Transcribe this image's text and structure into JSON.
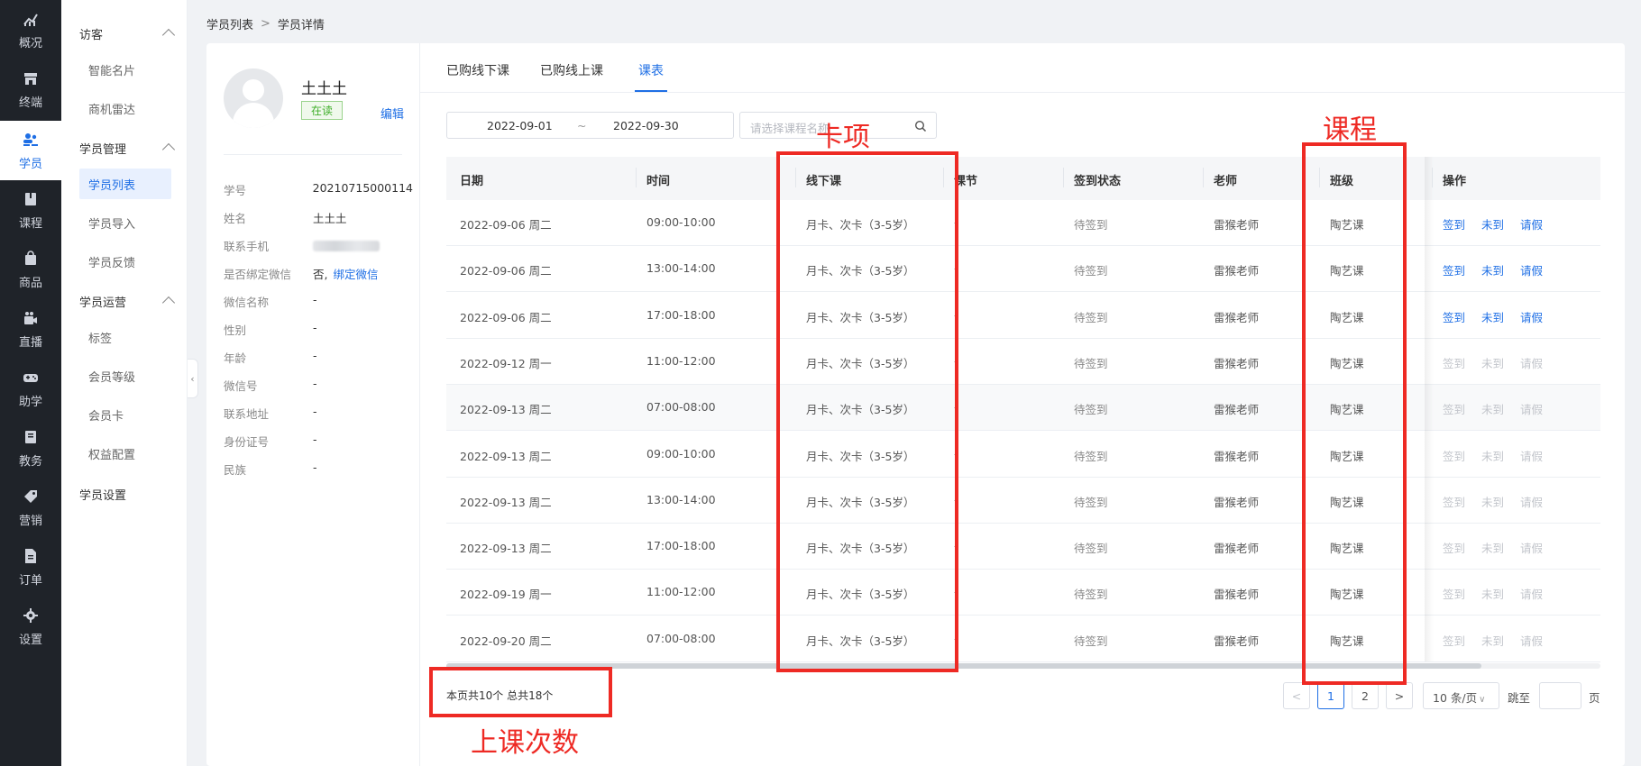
{
  "rail": {
    "items": [
      {
        "label": "概况",
        "icon": "chart-trend-icon"
      },
      {
        "label": "终端",
        "icon": "store-icon"
      },
      {
        "label": "学员",
        "icon": "users-icon",
        "active": true
      },
      {
        "label": "课程",
        "icon": "book-icon"
      },
      {
        "label": "商品",
        "icon": "bag-icon"
      },
      {
        "label": "直播",
        "icon": "video-camera-icon"
      },
      {
        "label": "助学",
        "icon": "gamepad-icon"
      },
      {
        "label": "教务",
        "icon": "notebook-icon"
      },
      {
        "label": "营销",
        "icon": "tag-icon"
      },
      {
        "label": "订单",
        "icon": "document-icon"
      },
      {
        "label": "设置",
        "icon": "gear-icon"
      }
    ]
  },
  "subnav": {
    "groups": [
      {
        "label": "访客",
        "items": [
          "智能名片",
          "商机雷达"
        ]
      },
      {
        "label": "学员管理",
        "items": [
          "学员列表",
          "学员导入",
          "学员反馈"
        ]
      },
      {
        "label": "学员运营",
        "items": [
          "标签",
          "会员等级",
          "会员卡",
          "权益配置"
        ]
      },
      {
        "label": "学员设置",
        "items": []
      }
    ],
    "active_item": "学员列表"
  },
  "breadcrumb": {
    "root": "学员列表",
    "sep": ">",
    "current": "学员详情"
  },
  "profile": {
    "name": "土土土",
    "status": "在读",
    "edit_label": "编辑",
    "fields": [
      {
        "key": "学号",
        "value": "20210715000114"
      },
      {
        "key": "姓名",
        "value": "土土土"
      },
      {
        "key": "联系手机",
        "value": ""
      },
      {
        "key": "是否绑定微信",
        "value": "否,",
        "link": "绑定微信"
      },
      {
        "key": "微信名称",
        "value": "-"
      },
      {
        "key": "性别",
        "value": "-"
      },
      {
        "key": "年龄",
        "value": "-"
      },
      {
        "key": "微信号",
        "value": "-"
      },
      {
        "key": "联系地址",
        "value": "-"
      },
      {
        "key": "身份证号",
        "value": "-"
      },
      {
        "key": "民族",
        "value": "-"
      }
    ]
  },
  "tabs": [
    "已购线下课",
    "已购线上课",
    "课表"
  ],
  "active_tab": "课表",
  "filters": {
    "date_start": "2022-09-01",
    "date_sep": "~",
    "date_end": "2022-09-30",
    "course_placeholder": "请选择课程名称"
  },
  "table": {
    "columns": [
      "日期",
      "时间",
      "线下课",
      "课节",
      "签到状态",
      "老师",
      "班级",
      "操作"
    ],
    "actions": [
      "签到",
      "未到",
      "请假"
    ],
    "rows": [
      {
        "date": "2022-09-06 周二",
        "time": "09:00-10:00",
        "course": "月卡、次卡（3-5岁）",
        "lesson": "-",
        "status": "待签到",
        "teacher": "雷猴老师",
        "class": "陶艺课",
        "actions_enabled": true
      },
      {
        "date": "2022-09-06 周二",
        "time": "13:00-14:00",
        "course": "月卡、次卡（3-5岁）",
        "lesson": "-",
        "status": "待签到",
        "teacher": "雷猴老师",
        "class": "陶艺课",
        "actions_enabled": true
      },
      {
        "date": "2022-09-06 周二",
        "time": "17:00-18:00",
        "course": "月卡、次卡（3-5岁）",
        "lesson": "-",
        "status": "待签到",
        "teacher": "雷猴老师",
        "class": "陶艺课",
        "actions_enabled": true
      },
      {
        "date": "2022-09-12 周一",
        "time": "11:00-12:00",
        "course": "月卡、次卡（3-5岁）",
        "lesson": "-",
        "status": "待签到",
        "teacher": "雷猴老师",
        "class": "陶艺课",
        "actions_enabled": false
      },
      {
        "date": "2022-09-13 周二",
        "time": "07:00-08:00",
        "course": "月卡、次卡（3-5岁）",
        "lesson": "-",
        "status": "待签到",
        "teacher": "雷猴老师",
        "class": "陶艺课",
        "actions_enabled": false
      },
      {
        "date": "2022-09-13 周二",
        "time": "09:00-10:00",
        "course": "月卡、次卡（3-5岁）",
        "lesson": "-",
        "status": "待签到",
        "teacher": "雷猴老师",
        "class": "陶艺课",
        "actions_enabled": false
      },
      {
        "date": "2022-09-13 周二",
        "time": "13:00-14:00",
        "course": "月卡、次卡（3-5岁）",
        "lesson": "-",
        "status": "待签到",
        "teacher": "雷猴老师",
        "class": "陶艺课",
        "actions_enabled": false
      },
      {
        "date": "2022-09-13 周二",
        "time": "17:00-18:00",
        "course": "月卡、次卡（3-5岁）",
        "lesson": "-",
        "status": "待签到",
        "teacher": "雷猴老师",
        "class": "陶艺课",
        "actions_enabled": false
      },
      {
        "date": "2022-09-19 周一",
        "time": "11:00-12:00",
        "course": "月卡、次卡（3-5岁）",
        "lesson": "-",
        "status": "待签到",
        "teacher": "雷猴老师",
        "class": "陶艺课",
        "actions_enabled": false
      },
      {
        "date": "2022-09-20 周二",
        "time": "07:00-08:00",
        "course": "月卡、次卡（3-5岁）",
        "lesson": "-",
        "status": "待签到",
        "teacher": "雷猴老师",
        "class": "陶艺课",
        "actions_enabled": false
      }
    ]
  },
  "pagination": {
    "summary": "本页共10个 总共18个",
    "prev": "<",
    "pages": [
      "1",
      "2"
    ],
    "current_page": "1",
    "next": ">",
    "page_size": "10 条/页",
    "jump_label": "跳至",
    "page_label": "页"
  },
  "annotations": {
    "card_label": "卡项",
    "class_label": "课程",
    "count_label": "上课次数",
    "color": "#ee2a24"
  }
}
